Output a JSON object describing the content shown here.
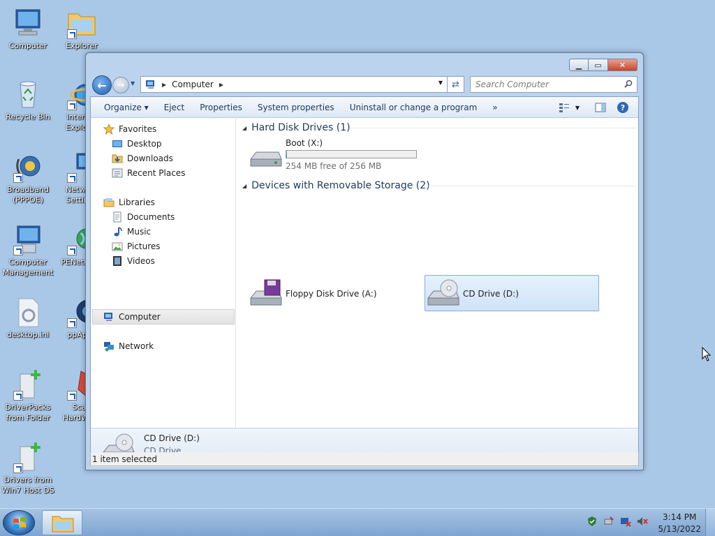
{
  "desktop": {
    "icons": [
      {
        "label": "Computer"
      },
      {
        "label": "Explorer"
      },
      {
        "label": "Recycle Bin"
      },
      {
        "label": "Internet Explorer"
      },
      {
        "label": "Broadband (PPPOE)"
      },
      {
        "label": "Network Settings"
      },
      {
        "label": "Computer Management"
      },
      {
        "label": "PENetwork"
      },
      {
        "label": "desktop.ini"
      },
      {
        "label": "ppApps"
      },
      {
        "label": "DriverPacks from Folder"
      },
      {
        "label": "Scan HardWare"
      },
      {
        "label": "Drivers from Win7 Host DS"
      }
    ]
  },
  "window": {
    "title_buttons": {
      "minimize": "▁",
      "maximize": "▭",
      "close": "✕"
    },
    "address": {
      "crumbs": [
        "Computer"
      ]
    },
    "search": {
      "placeholder": "Search Computer"
    },
    "toolbar": {
      "organize": "Organize ▾",
      "eject": "Eject",
      "properties": "Properties",
      "system_properties": "System properties",
      "uninstall": "Uninstall or change a program",
      "more": "»",
      "help": "?"
    },
    "nav": {
      "favorites": "Favorites",
      "desktop": "Desktop",
      "downloads": "Downloads",
      "recent_places": "Recent Places",
      "libraries": "Libraries",
      "documents": "Documents",
      "music": "Music",
      "pictures": "Pictures",
      "videos": "Videos",
      "computer": "Computer",
      "network": "Network"
    },
    "groups": {
      "hard_disk": "Hard Disk Drives (1)",
      "removable": "Devices with Removable Storage (2)"
    },
    "drives": {
      "boot": {
        "name": "Boot (X:)",
        "free": "254 MB free of 256 MB",
        "used_fraction": 0.008
      },
      "floppy": {
        "name": "Floppy Disk Drive (A:)"
      },
      "cd": {
        "name": "CD Drive (D:)"
      }
    },
    "details": {
      "name": "CD Drive (D:)",
      "type": "CD Drive"
    },
    "status": "1 item selected"
  },
  "taskbar": {
    "time": "3:14 PM",
    "date": "5/13/2022"
  }
}
